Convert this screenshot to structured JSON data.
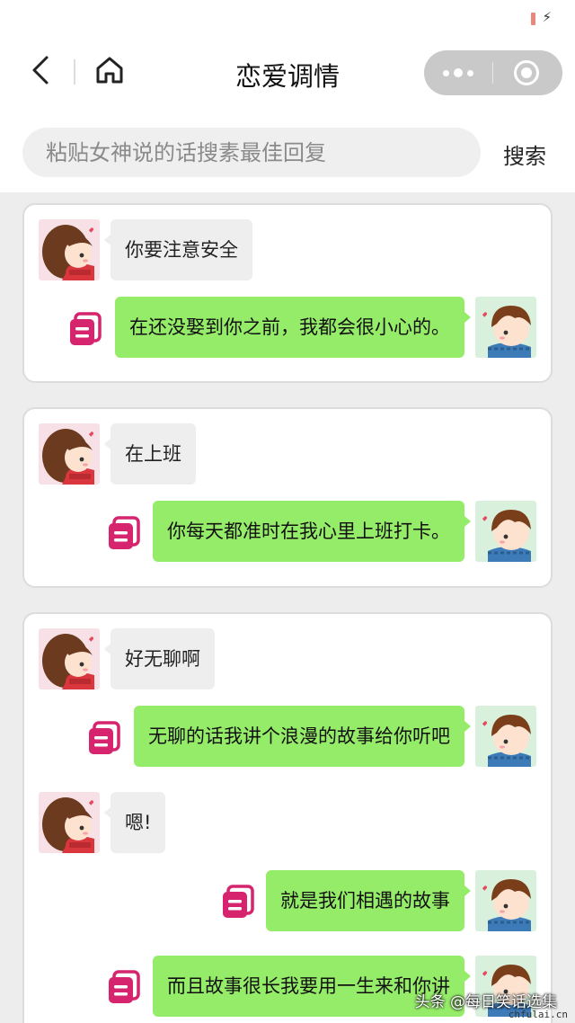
{
  "nav": {
    "title": "恋爱调情"
  },
  "search": {
    "placeholder": "粘贴女神说的话搜素最佳回复",
    "button_label": "搜索"
  },
  "colors": {
    "bubble_right": "#95ec69",
    "bubble_left": "#eeeeee",
    "copy_icon": "#d6246e",
    "background": "#ededed"
  },
  "cards": [
    {
      "messages": [
        {
          "side": "left",
          "text": "你要注意安全"
        },
        {
          "side": "right",
          "text": "在还没娶到你之前，我都会很小心的。"
        }
      ]
    },
    {
      "messages": [
        {
          "side": "left",
          "text": "在上班"
        },
        {
          "side": "right",
          "text": "你每天都准时在我心里上班打卡。"
        }
      ]
    },
    {
      "messages": [
        {
          "side": "left",
          "text": "好无聊啊"
        },
        {
          "side": "right",
          "text": "无聊的话我讲个浪漫的故事给你听吧"
        },
        {
          "side": "left",
          "text": "嗯!"
        },
        {
          "side": "right",
          "text": "就是我们相遇的故事"
        },
        {
          "side": "right",
          "text": "而且故事很长我要用一生来和你讲"
        }
      ]
    }
  ],
  "watermark": {
    "text": "头条 @每日笑话选集",
    "url": "chfulai.cn"
  }
}
